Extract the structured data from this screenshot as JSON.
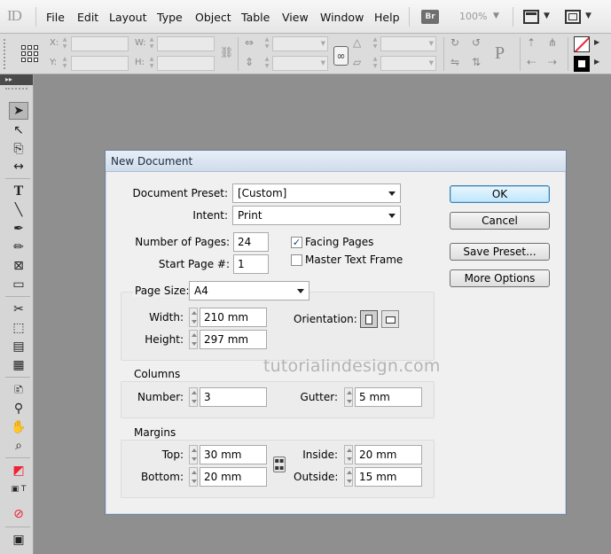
{
  "app": {
    "logo": "ID",
    "menu": [
      "File",
      "Edit",
      "Layout",
      "Type",
      "Object",
      "Table",
      "View",
      "Window",
      "Help"
    ],
    "bridge_label": "Br",
    "zoom": "100%"
  },
  "control_panel": {
    "x_label": "X:",
    "y_label": "Y:",
    "w_label": "W:",
    "h_label": "H:",
    "p_glyph": "P"
  },
  "dialog": {
    "title": "New Document",
    "document_preset_label": "Document Preset:",
    "document_preset_value": "[Custom]",
    "intent_label": "Intent:",
    "intent_value": "Print",
    "number_of_pages_label": "Number of Pages:",
    "number_of_pages_value": "24",
    "start_page_label": "Start Page #:",
    "start_page_value": "1",
    "facing_pages_label": "Facing Pages",
    "facing_pages_checked": true,
    "master_text_frame_label": "Master Text Frame",
    "master_text_frame_checked": false,
    "page_size_label": "Page Size:",
    "page_size_value": "A4",
    "width_label": "Width:",
    "width_value": "210 mm",
    "height_label": "Height:",
    "height_value": "297 mm",
    "orientation_label": "Orientation:",
    "columns_title": "Columns",
    "number_label": "Number:",
    "number_value": "3",
    "gutter_label": "Gutter:",
    "gutter_value": "5 mm",
    "margins_title": "Margins",
    "top_label": "Top:",
    "top_value": "30 mm",
    "bottom_label": "Bottom:",
    "bottom_value": "20 mm",
    "inside_label": "Inside:",
    "inside_value": "20 mm",
    "outside_label": "Outside:",
    "outside_value": "15 mm",
    "buttons": {
      "ok": "OK",
      "cancel": "Cancel",
      "save_preset": "Save Preset...",
      "more_options": "More Options"
    },
    "watermark": "tutorialindesign.com"
  },
  "colors": {
    "pasteboard": "#8f8f8f",
    "dialog_bg": "#f0f0f0",
    "titlebar": "#dbe6f2",
    "default_button": "#bee6fd"
  }
}
